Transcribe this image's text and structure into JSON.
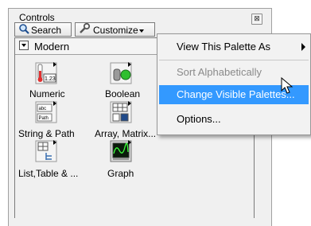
{
  "window": {
    "title": "Controls",
    "close_label": "⊠"
  },
  "toolbar": {
    "search_label": "Search",
    "customize_label": "Customize"
  },
  "category": {
    "label": "Modern"
  },
  "palettes": [
    {
      "name": "Numeric",
      "icon": "numeric-icon"
    },
    {
      "name": "Boolean",
      "icon": "boolean-icon"
    },
    {
      "name": "String & Path",
      "icon": "string-path-icon"
    },
    {
      "name": "Array, Matrix...",
      "icon": "array-matrix-icon"
    },
    {
      "name": "List,Table & ...",
      "icon": "list-table-icon"
    },
    {
      "name": "Graph",
      "icon": "graph-icon"
    }
  ],
  "menu": {
    "items": [
      {
        "label": "View This Palette As",
        "submenu": true,
        "state": "normal"
      },
      {
        "label": "Sort Alphabetically",
        "state": "disabled"
      },
      {
        "label": "Change Visible Palettes...",
        "state": "highlighted"
      },
      {
        "label": "Options...",
        "state": "normal"
      }
    ]
  },
  "colors": {
    "highlight": "#3399ff",
    "window_bg": "#f0f0f0"
  }
}
